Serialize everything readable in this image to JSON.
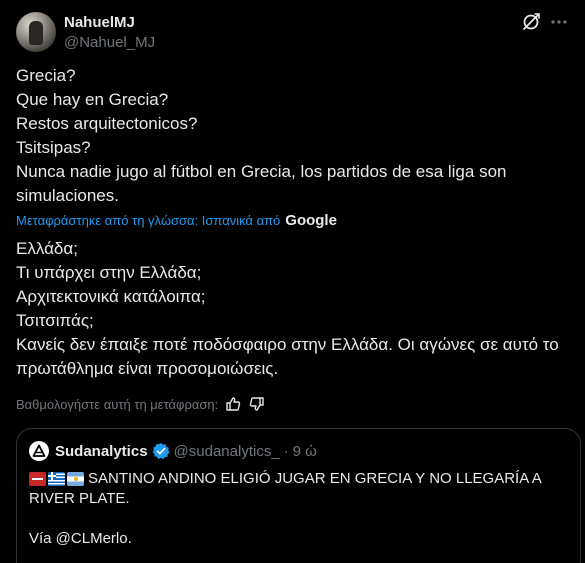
{
  "author": {
    "display_name": "NahuelMJ",
    "handle": "@Nahuel_MJ"
  },
  "icons": {
    "grok": "grok-icon",
    "more": "more-icon",
    "thumbs_up": "thumbs-up-icon",
    "thumbs_down": "thumbs-down-icon",
    "verified": "verified-badge-icon"
  },
  "tweet": {
    "lines": [
      "Grecia?",
      "Que hay en Grecia?",
      "Restos arquitectonicos?",
      "Tsitsipas?",
      "Nunca nadie jugo al fútbol en Grecia, los partidos de esa liga son simulaciones."
    ]
  },
  "translation": {
    "label": "Μεταφράστηκε από τη γλώσσα: Ισπανικά από",
    "provider": "Google",
    "lines": [
      "Ελλάδα;",
      "Τι υπάρχει στην Ελλάδα;",
      "Αρχιτεκτονικά κατάλοιπα;",
      "Τσιτσιπάς;",
      "Κανείς δεν έπαιξε ποτέ ποδόσφαιρο στην Ελλάδα. Οι αγώνες σε αυτό το πρωτάθλημα είναι προσομοιώσεις."
    ],
    "rate_label": "Βαθμολογήστε αυτή τη μετάφραση:"
  },
  "quote": {
    "display_name": "Sudanalytics",
    "handle": "@sudanalytics_",
    "separator": "·",
    "time": "9 ώ",
    "text": "SANTINO ANDINO ELIGIÓ JUGAR EN GRECIA Y NO LLEGARÍA A RIVER PLATE.",
    "via": "Vía @CLMerlo.",
    "flags": [
      "no-entry",
      "greece",
      "argentina"
    ]
  },
  "colors": {
    "background": "#000000",
    "text": "#e7e9ea",
    "secondary": "#71767b",
    "accent": "#1d9bf0",
    "border": "#2f3336"
  }
}
